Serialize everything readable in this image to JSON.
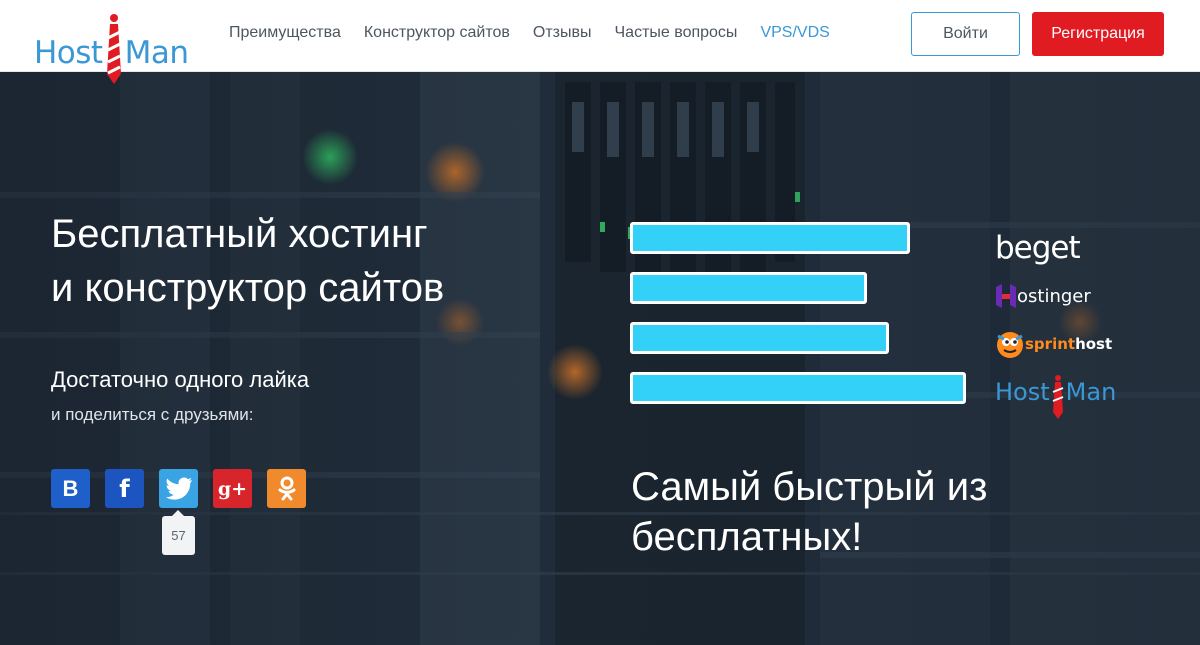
{
  "brand": {
    "logo_text_left": "Host",
    "logo_text_right": "Man"
  },
  "nav": {
    "items": [
      {
        "label": "Преимущества"
      },
      {
        "label": "Конструктор сайтов"
      },
      {
        "label": "Отзывы"
      },
      {
        "label": "Частые вопросы"
      },
      {
        "label": "VPS/VDS"
      }
    ]
  },
  "auth": {
    "login_label": "Войти",
    "register_label": "Регистрация"
  },
  "hero": {
    "title_line1": "Бесплатный хостинг",
    "title_line2": "и конструктор сайтов",
    "share_title": "Достаточно одного лайка",
    "share_subtitle": "и поделиться с друзьями:",
    "share_count": "57",
    "tagline_line1": "Самый быстрый из",
    "tagline_line2": "бесплатных!"
  },
  "socials": [
    {
      "name": "vk",
      "glyph": "В"
    },
    {
      "name": "facebook",
      "glyph": "f"
    },
    {
      "name": "twitter",
      "glyph": ""
    },
    {
      "name": "google-plus",
      "glyph": "g+"
    },
    {
      "name": "odnoklassniki",
      "glyph": ""
    }
  ],
  "comparison": {
    "bar_color": "#33d0f8",
    "items": [
      {
        "provider": "beget",
        "value": 280
      },
      {
        "provider": "hostinger",
        "value": 237
      },
      {
        "provider": "sprinthost",
        "value": 259
      },
      {
        "provider": "hostman",
        "value": 336
      }
    ],
    "providers": {
      "beget": "beget",
      "hostinger": "ostinger",
      "sprinthost_a": "sprint",
      "sprinthost_b": "host",
      "hostman_a": "Host",
      "hostman_b": "Man"
    }
  },
  "colors": {
    "brand_blue": "#3a98d6",
    "register_red": "#e11b22"
  }
}
